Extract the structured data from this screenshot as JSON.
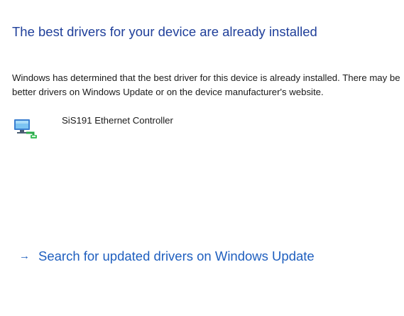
{
  "heading": "The best drivers for your device are already installed",
  "description": {
    "line1": "Windows has determined that the best driver for this device is already installed. There may be",
    "line2": "better drivers on Windows Update or on the device manufacturer's website."
  },
  "device": {
    "icon": "network-adapter-icon",
    "name": "SiS191 Ethernet Controller"
  },
  "update_link": {
    "arrow": "→",
    "label": "Search for updated drivers on Windows Update"
  },
  "colors": {
    "heading": "#1f3f9a",
    "link": "#1f5fbf",
    "text": "#1a1a1a",
    "background": "#ffffff"
  }
}
